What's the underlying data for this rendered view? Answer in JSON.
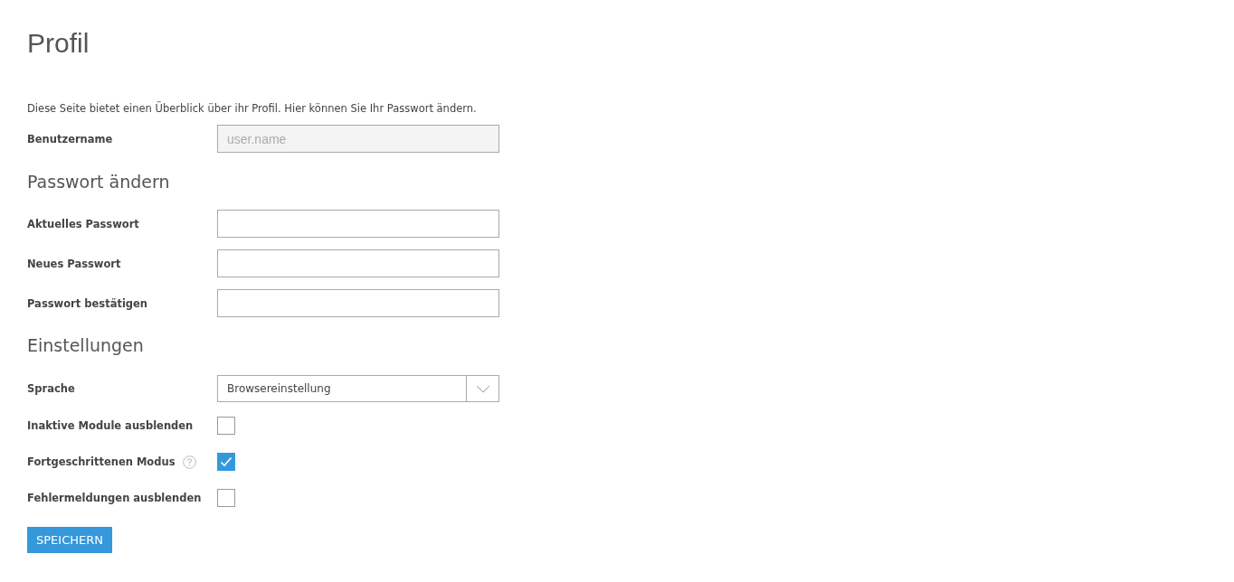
{
  "page": {
    "title": "Profil",
    "intro": "Diese Seite bietet einen Überblick über ihr Profil. Hier können Sie Ihr Passwort ändern."
  },
  "username": {
    "label": "Benutzername",
    "value": "user.name",
    "disabled": true
  },
  "password_section": {
    "heading": "Passwort ändern",
    "fields": [
      {
        "label": "Aktuelles Passwort"
      },
      {
        "label": "Neues Passwort"
      },
      {
        "label": "Passwort bestätigen"
      }
    ]
  },
  "settings_section": {
    "heading": "Einstellungen",
    "language": {
      "label": "Sprache",
      "value": "Browsereinstellung"
    },
    "options": [
      {
        "label": "Inaktive Module ausblenden",
        "checked": false,
        "help": false
      },
      {
        "label": "Fortgeschrittenen Modus",
        "checked": true,
        "help": true
      },
      {
        "label": "Fehlermeldungen ausblenden",
        "checked": false,
        "help": false
      }
    ]
  },
  "save_button": {
    "label": "SPEICHERN"
  }
}
